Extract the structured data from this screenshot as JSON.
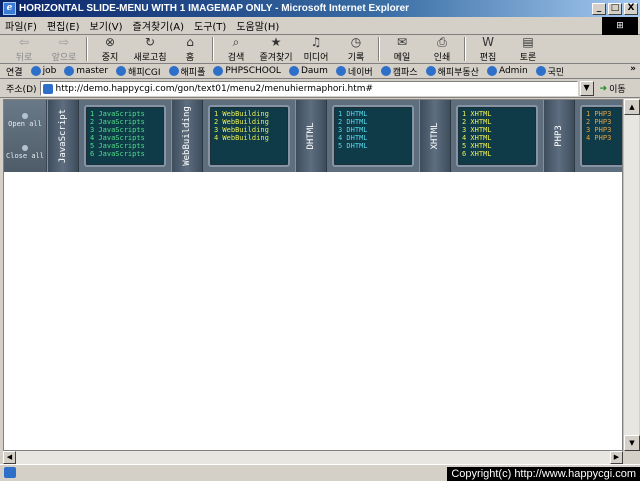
{
  "window": {
    "title": "HORIZONTAL SLIDE-MENU WITH 1 IMAGEMAP ONLY - Microsoft Internet Explorer",
    "minimize": "_",
    "maximize": "□",
    "close": "X"
  },
  "menubar": {
    "items": [
      "파일(F)",
      "편집(E)",
      "보기(V)",
      "즐겨찾기(A)",
      "도구(T)",
      "도움말(H)"
    ],
    "logo": "⊞"
  },
  "toolbar": {
    "buttons": [
      {
        "label": "뒤로",
        "icon": "back-arrow-icon",
        "glyph": "⇦",
        "disabled": true
      },
      {
        "label": "앞으로",
        "icon": "forward-arrow-icon",
        "glyph": "⇨",
        "disabled": true
      },
      {
        "label": "중지",
        "icon": "stop-icon",
        "glyph": "⊗",
        "disabled": false
      },
      {
        "label": "새로고침",
        "icon": "refresh-icon",
        "glyph": "↻",
        "disabled": false
      },
      {
        "label": "홈",
        "icon": "home-icon",
        "glyph": "⌂",
        "disabled": false
      },
      {
        "label": "검색",
        "icon": "search-icon",
        "glyph": "⌕",
        "disabled": false
      },
      {
        "label": "즐겨찾기",
        "icon": "favorites-icon",
        "glyph": "★",
        "disabled": false
      },
      {
        "label": "미디어",
        "icon": "media-icon",
        "glyph": "♫",
        "disabled": false
      },
      {
        "label": "기록",
        "icon": "history-icon",
        "glyph": "◷",
        "disabled": false
      },
      {
        "label": "메일",
        "icon": "mail-icon",
        "glyph": "✉",
        "disabled": false
      },
      {
        "label": "인쇄",
        "icon": "print-icon",
        "glyph": "⎙",
        "disabled": false
      },
      {
        "label": "편집",
        "icon": "edit-icon",
        "glyph": "W",
        "disabled": false
      },
      {
        "label": "토론",
        "icon": "discuss-icon",
        "glyph": "▤",
        "disabled": false
      }
    ]
  },
  "links": {
    "label": "연결",
    "items": [
      "job",
      "master",
      "해피CGI",
      "해피폴",
      "PHPSCHOOL",
      "Daum",
      "네이버",
      "캠파스",
      "해피부동산",
      "Admin",
      "국민"
    ],
    "more": "»"
  },
  "address": {
    "label": "주소(D)",
    "url": "http://demo.happycgi.com/gon/text01/menu2/menuhiermaphori.htm#",
    "go_label": "이동"
  },
  "slide_menu": {
    "controls": {
      "open": "Open all",
      "close": "Close all"
    },
    "tabs": [
      {
        "label": "JavaScript",
        "items": [
          "1 JavaScripts",
          "2 JavaScripts",
          "3 JavaScripts",
          "4 JavaScripts",
          "5 JavaScripts",
          "6 JavaScripts"
        ],
        "color": "#4ee08a"
      },
      {
        "label": "WebBuilding",
        "items": [
          "1 WebBuilding",
          "2 WebBuilding",
          "3 WebBuilding",
          "4 WebBuilding"
        ],
        "color": "#e7ee55"
      },
      {
        "label": "DHTML",
        "items": [
          "1 DHTML",
          "2 DHTML",
          "3 DHTML",
          "4 DHTML",
          "5 DHTML"
        ],
        "color": "#55d6ee"
      },
      {
        "label": "XHTML",
        "items": [
          "1 XHTML",
          "2 XHTML",
          "3 XHTML",
          "4 XHTML",
          "5 XHTML",
          "6 XHTML"
        ],
        "color": "#eef055"
      },
      {
        "label": "PHP3",
        "items": [
          "1 PHP3",
          "2 PHP3",
          "3 PHP3",
          "4 PHP3"
        ],
        "color": "#e8a040"
      }
    ]
  },
  "status": {
    "copyright": "Copyright(c) http://www.happycgi.com"
  }
}
